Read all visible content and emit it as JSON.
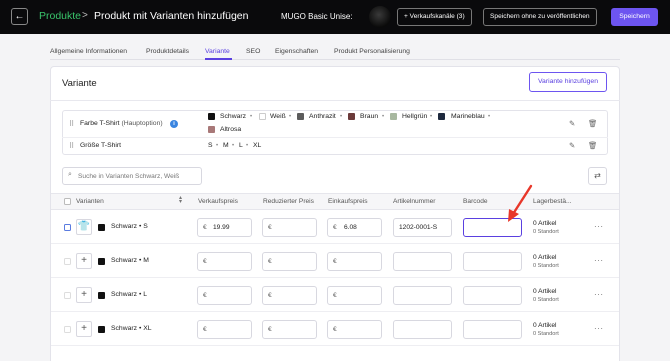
{
  "header": {
    "back_icon": "arrow-left-icon",
    "breadcrumb_root": "Produkte",
    "breadcrumb_sep": ">",
    "page_title": "Produkt mit Varianten hinzufügen",
    "product_name": "MUGO Basic Unise:",
    "sales_channels": "+ Verkaufskanäle (3)",
    "save_draft": "Speichern ohne zu veröffentlichen",
    "save": "Speichern",
    "accent_color": "#6d55f0"
  },
  "tabs": [
    {
      "label": "Allgemeine Informationen"
    },
    {
      "label": "Produktdetails"
    },
    {
      "label": "Variante"
    },
    {
      "label": "SEO"
    },
    {
      "label": "Eigenschaften"
    },
    {
      "label": "Produkt Personalisierung"
    }
  ],
  "active_tab": "Variante",
  "variants_section": {
    "title": "Variante",
    "add_button": "Variante hinzufügen"
  },
  "properties": [
    {
      "name": "Farbe T-Shirt",
      "suffix": "(Hauptoption)",
      "info_icon": "i",
      "options": [
        {
          "label": "Schwarz",
          "color": "#111111"
        },
        {
          "label": "Weiß",
          "color": "#ffffff"
        },
        {
          "label": "Anthrazit",
          "color": "#5c5c5c"
        },
        {
          "label": "Braun",
          "color": "#6b3a3a"
        },
        {
          "label": "Hellgrün",
          "color": "#a8b8a0"
        },
        {
          "label": "Marineblau",
          "color": "#1e2a3e"
        },
        {
          "label": "Altrosa",
          "color": "#a87878"
        }
      ]
    },
    {
      "name": "Größe T-Shirt",
      "options": [
        {
          "label": "S"
        },
        {
          "label": "M"
        },
        {
          "label": "L"
        },
        {
          "label": "XL"
        }
      ]
    }
  ],
  "separator_dot": "•",
  "search": {
    "placeholder": "Suche in Varianten Schwarz, Weiß"
  },
  "table": {
    "headers": [
      "Varianten",
      "Verkaufspreis",
      "Reduzierter Preis",
      "Einkaufspreis",
      "Artikelnummer",
      "Barcode",
      "Lagerbestä..."
    ],
    "currency": "€",
    "rows": [
      {
        "color": "Schwarz",
        "size": "S",
        "sale_price": "19.99",
        "reduced_price": "",
        "purchase_price": "6.08",
        "sku": "1202-0001-S",
        "barcode": "",
        "stock": "0 Artikel",
        "stock_location": "0 Standort"
      },
      {
        "color": "Schwarz",
        "size": "M",
        "sale_price": "",
        "reduced_price": "",
        "purchase_price": "",
        "sku": "",
        "barcode": "",
        "stock": "0 Artikel",
        "stock_location": "0 Standort"
      },
      {
        "color": "Schwarz",
        "size": "L",
        "sale_price": "",
        "reduced_price": "",
        "purchase_price": "",
        "sku": "",
        "barcode": "",
        "stock": "0 Artikel",
        "stock_location": "0 Standort"
      },
      {
        "color": "Schwarz",
        "size": "XL",
        "sale_price": "",
        "reduced_price": "",
        "purchase_price": "",
        "sku": "",
        "barcode": "",
        "stock": "0 Artikel",
        "stock_location": "0 Standort"
      }
    ]
  },
  "annotation_arrow_color": "#e8372a"
}
